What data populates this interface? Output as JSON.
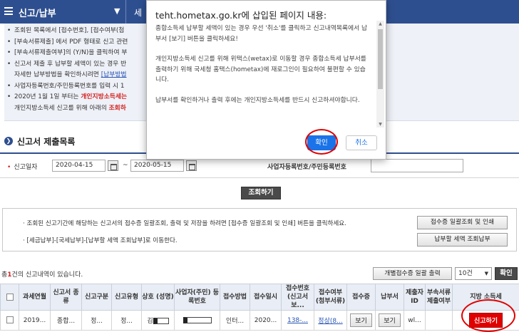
{
  "topnav": {
    "title": "신고/납부",
    "next_fragment": "세"
  },
  "info": {
    "items": [
      {
        "text": "조회된 목록에서 [접수번호], [접수여부(첨"
      },
      {
        "text": "[부속서류제출] 에서 PDF 형태로 신고 관련"
      },
      {
        "text": "[부속서류제출여부]의 (Y/N)을 클릭하여 부"
      },
      {
        "text": "신고서 제출 후 납부할 세액이 있는 경우 반"
      },
      {
        "text": "자세한 납부방법을 확인하시려면 ",
        "link": "[납부방법"
      },
      {
        "text": "사업자등록번호/주민등록번호를 입력 시 1"
      },
      {
        "text_pre": "2020년 1월 1일 부터는 ",
        "red": "개인지방소득세는"
      },
      {
        "text": "개인지방소득세 신고를 위해 아래의 ",
        "red": "조회하"
      }
    ]
  },
  "section_title": "신고서 제출목록",
  "search": {
    "date_label": "신고일자",
    "date_from": "2020-04-15",
    "tilde": "~",
    "date_to": "2020-05-15",
    "id_label": "사업자등록번호/주민등록번호",
    "query_button": "조회하기"
  },
  "notice2": {
    "line1": "· 조회된 신고기간에 해당하는 신고서의 접수증 일괄조회, 출력 및 저장을 하려면 [접수증 일괄조회 및 인쇄] 버튼을 클릭하세요.",
    "line2": "· [세금납부]-[국세납부]-[납부할 세액 조회납부]로 이동한다.",
    "btn_receipt": "접수증 일괄조회 및 인쇄",
    "btn_pay": "납부할 세액 조회납부"
  },
  "list": {
    "count_pre": "총",
    "count_num": "1",
    "count_post": "건의 신고내역이 있습니다.",
    "print_button": "개별접수증 일괄 출력",
    "page_size": "10건",
    "ok_button": "확인"
  },
  "table": {
    "headers": [
      "",
      "과세연월",
      "신고서 종류",
      "신고구분",
      "신고유형",
      "상호 (성명)",
      "사업자(주민) 등록번호",
      "접수방법",
      "접수일시",
      "접수번호 (신고서보...",
      "접수여부 (첨부서류)",
      "접수증",
      "납부서",
      "제출자 ID",
      "부속서류 제출여부",
      "지방 소득세"
    ],
    "row": {
      "period": "2019...",
      "type": "종합...",
      "kind": "정...",
      "mode": "정...",
      "name_prefix": "김",
      "method": "인터...",
      "datetime": "2020...",
      "receipt_no": "138-...",
      "status": "정상(8...",
      "receipt_btn": "보기",
      "bill_btn": "보기",
      "submitter": "wl...",
      "local_tax_btn": "신고하기"
    }
  },
  "dialog": {
    "title": "teht.hometax.go.kr에 삽입된 페이지 내용:",
    "p1": "종합소득세 납부할 세액이 있는 경우 우선 '취소'를 클릭하고 신고내역목록에서 납부서 [보기] 버튼을 클릭하세요!",
    "p2": "개인지방소득세 신고를 위해 위택스(wetax)로 이동할 경우 종합소득세 납부서를 출력하기 위해 국세청 홈택스(hometax)에 재로그인이 필요하여 불편할 수 있습니다.",
    "p3": "납부서를 확인하거나 출력 후에는 개인지방소득세를 반드시 신고하셔야합니다.",
    "ok": "확인",
    "cancel": "취소"
  },
  "colors": {
    "nav": "#2e4f8f",
    "accent_red": "#e00000",
    "dialog_primary": "#1a73e8"
  }
}
